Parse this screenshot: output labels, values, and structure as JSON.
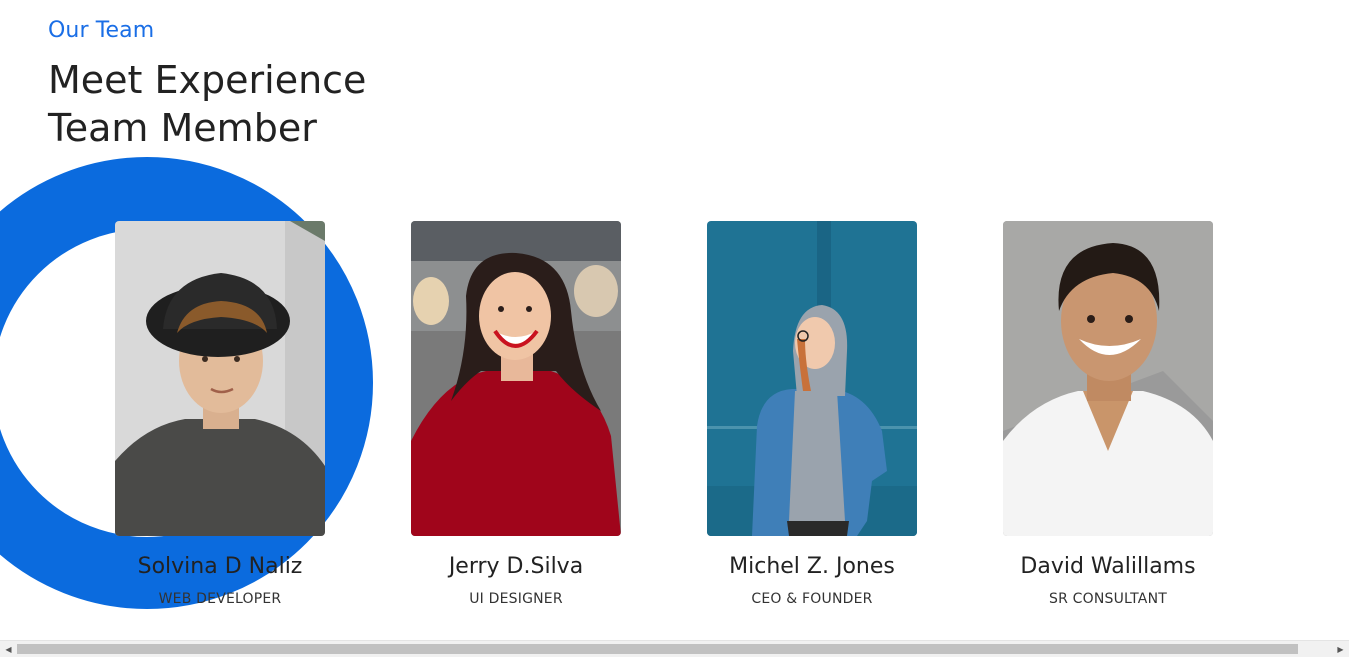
{
  "section": {
    "eyebrow": "Our Team",
    "heading_line1": "Meet Experience",
    "heading_line2": "Team Member"
  },
  "team": [
    {
      "name": "Solvina D Naliz",
      "role": "WEB DEVELOPER"
    },
    {
      "name": "Jerry D.Silva",
      "role": "UI DESIGNER"
    },
    {
      "name": "Michel Z. Jones",
      "role": "CEO & FOUNDER"
    },
    {
      "name": "David Walillams",
      "role": "SR CONSULTANT"
    }
  ],
  "colors": {
    "accent": "#1a6ee6",
    "ring": "#0b6bde"
  },
  "scrollbar": {
    "left_arrow_icon": "triangle-left-icon",
    "right_arrow_icon": "triangle-right-icon"
  }
}
